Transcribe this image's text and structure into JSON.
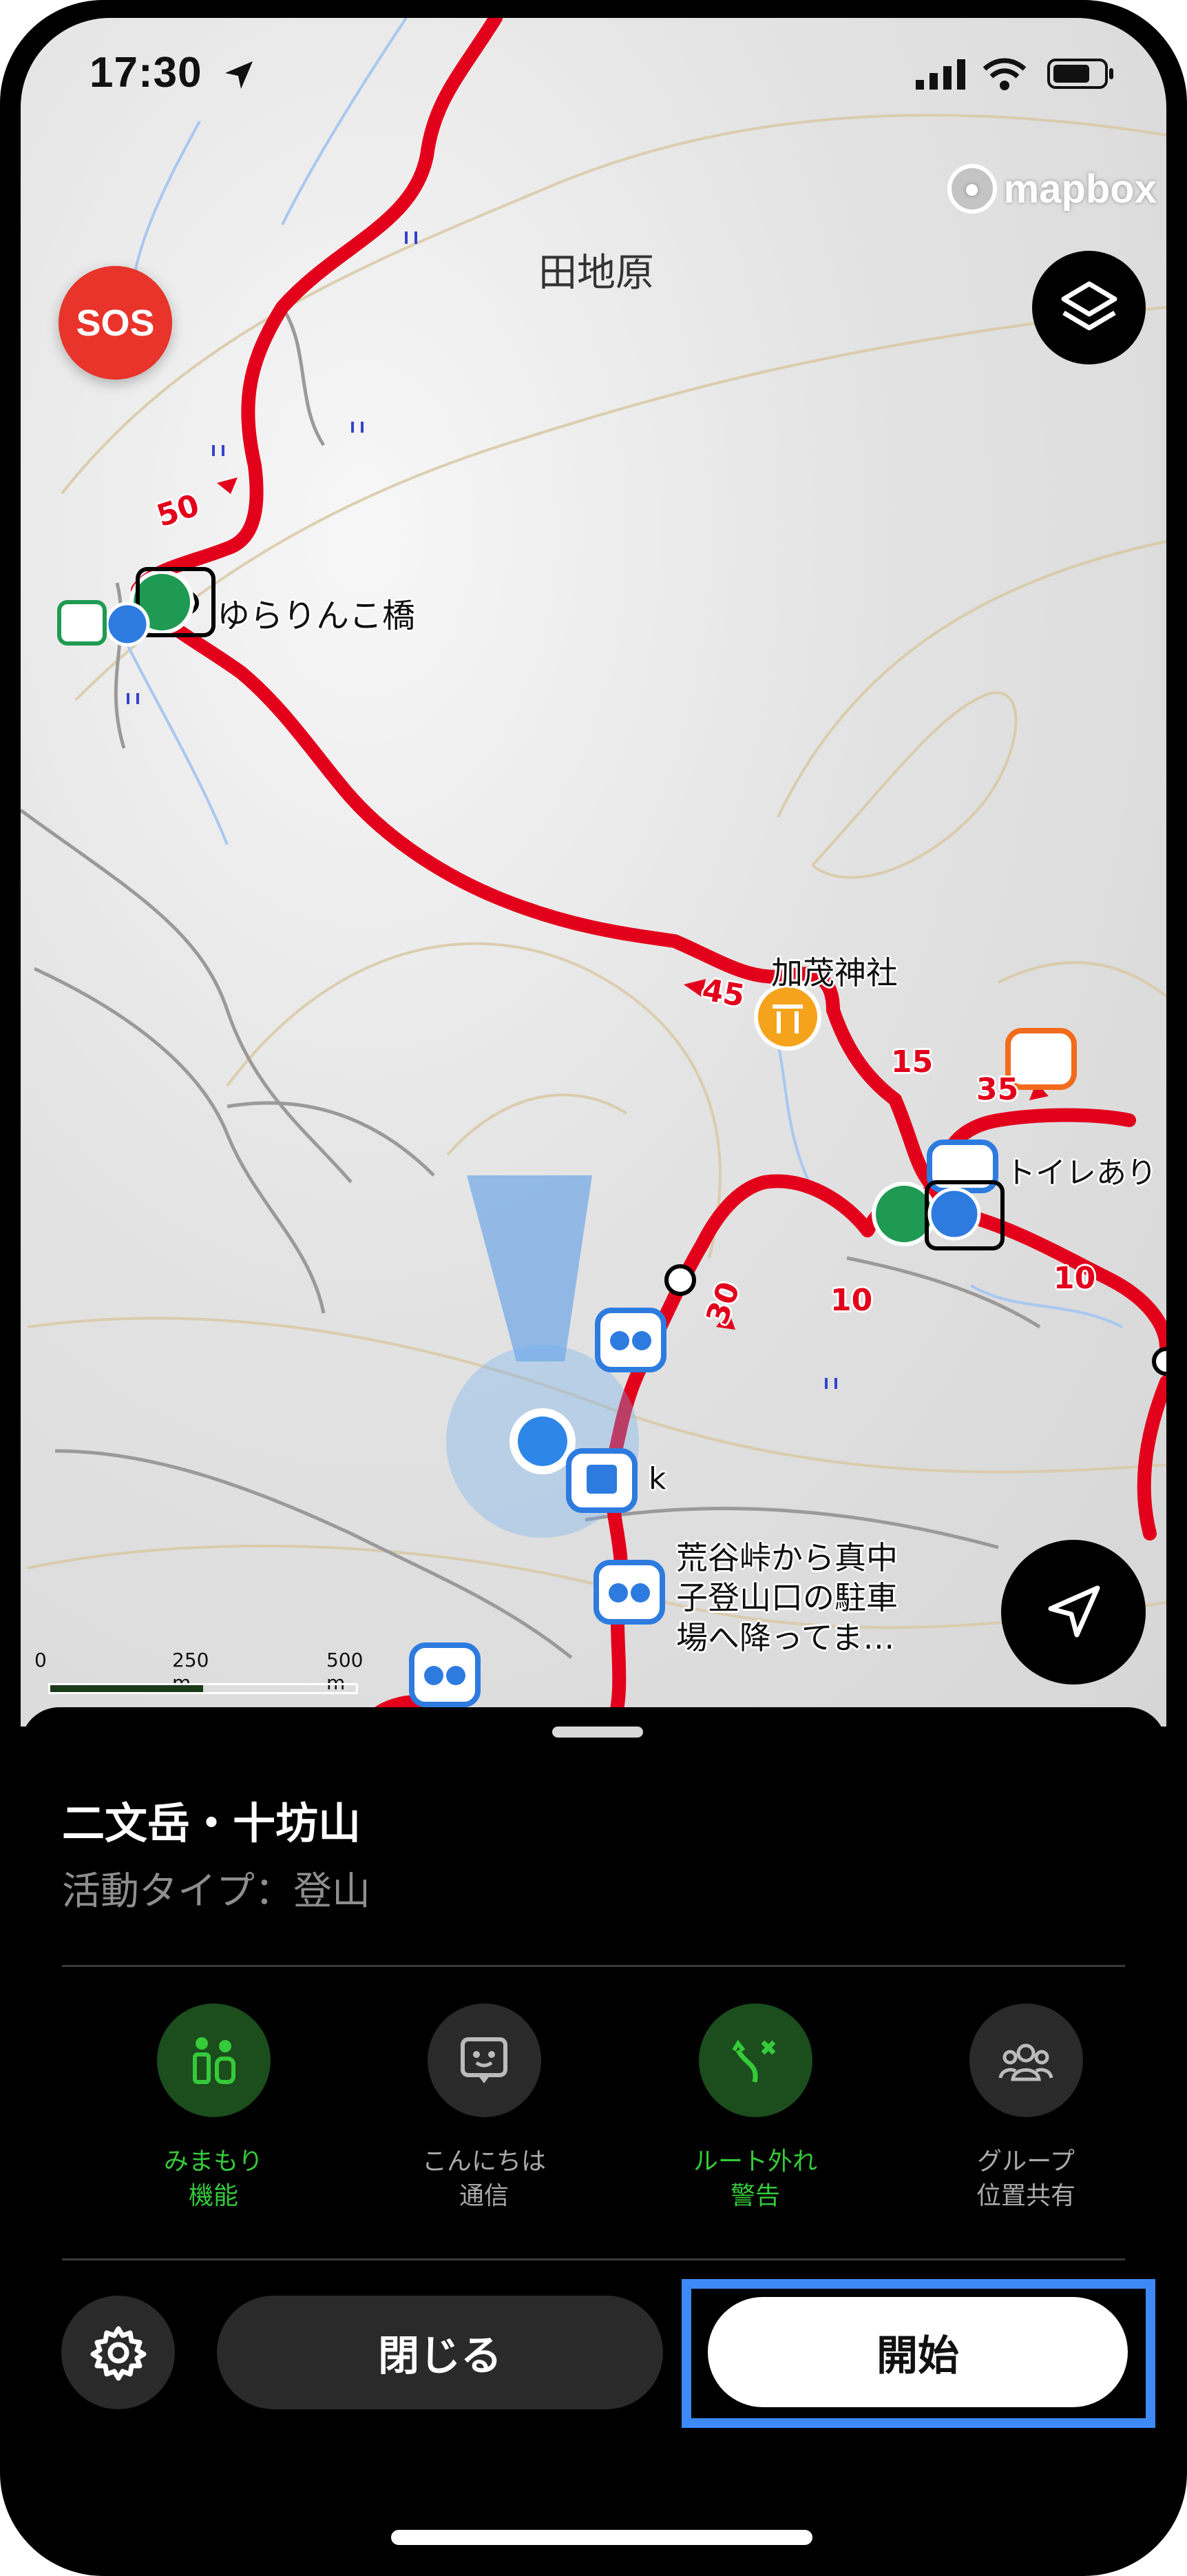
{
  "status_bar": {
    "time": "17:30"
  },
  "map": {
    "attribution": "mapbox",
    "sos_label": "SOS",
    "labels": {
      "area": "田地原",
      "bridge": "ゆらりんこ橋",
      "shrine": "加茂神社",
      "toilet": "トイレあり",
      "stop_k": "k",
      "note": "荒谷峠から真中\n子登山口の駐車\n場へ降ってま…"
    },
    "route_markers": [
      "50",
      "45",
      "15",
      "35",
      "30",
      "10",
      "10"
    ],
    "scale": {
      "t0": "0",
      "t1": "250 m",
      "t2": "500 m"
    }
  },
  "sheet": {
    "title": "二文岳・十坊山",
    "activity_type": "活動タイプ：登山",
    "features": [
      {
        "label": "みまもり\n機能",
        "active": true,
        "icon": "watch-over-icon"
      },
      {
        "label": "こんにちは\n通信",
        "active": false,
        "icon": "hello-comm-icon"
      },
      {
        "label": "ルート外れ\n警告",
        "active": true,
        "icon": "off-route-icon"
      },
      {
        "label": "グループ\n位置共有",
        "active": false,
        "icon": "group-location-icon"
      }
    ],
    "close_label": "閉じる",
    "start_label": "開始"
  },
  "colors": {
    "accent_green": "#36c93a",
    "active_circle": "#1b4d1d",
    "route_red": "#e3001b",
    "highlight_blue": "#3d8af7"
  }
}
